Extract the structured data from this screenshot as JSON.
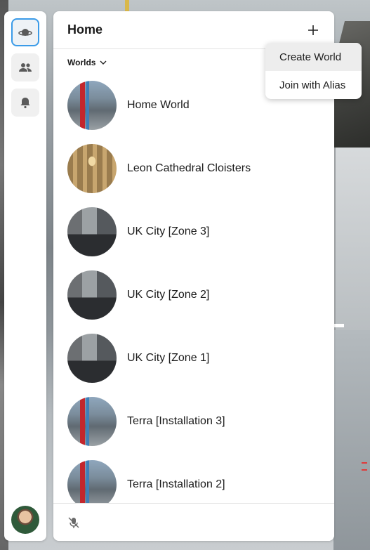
{
  "header": {
    "title": "Home",
    "add_icon": "plus-icon"
  },
  "filter": {
    "label": "Worlds",
    "icon": "chevron-down-icon"
  },
  "dropdown": {
    "items": [
      {
        "label": "Create World"
      },
      {
        "label": "Join with Alias"
      }
    ]
  },
  "rail": {
    "items": [
      {
        "icon": "worlds-icon",
        "active": true
      },
      {
        "icon": "people-icon",
        "active": false
      },
      {
        "icon": "bell-icon",
        "active": false
      }
    ],
    "avatar_icon": "user-avatar"
  },
  "worlds": [
    {
      "name": "Home World",
      "thumb": "home"
    },
    {
      "name": "Leon Cathedral Cloisters",
      "thumb": "cathedral"
    },
    {
      "name": "UK City [Zone 3]",
      "thumb": "city"
    },
    {
      "name": "UK City [Zone 2]",
      "thumb": "city"
    },
    {
      "name": "UK City [Zone 1]",
      "thumb": "city"
    },
    {
      "name": "Terra [Installation 3]",
      "thumb": "home"
    },
    {
      "name": "Terra [Installation 2]",
      "thumb": "home"
    }
  ],
  "footer": {
    "mic_icon": "mic-off-icon"
  },
  "colors": {
    "accent": "#3b9be8",
    "panel_bg": "#ffffff",
    "text": "#1b1b1b"
  }
}
